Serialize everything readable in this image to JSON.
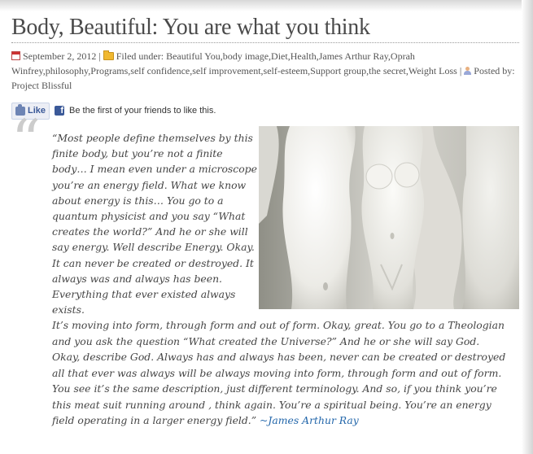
{
  "post": {
    "title": "Body, Beautiful: You are what you think",
    "meta": {
      "date": "September 2, 2012",
      "filed_under_label": "Filed under:",
      "categories": "Beautiful You,body image,Diet,Health,James Arthur Ray,Oprah Winfrey,philosophy,Programs,self confidence,self improvement,self-esteem,Support group,the secret,Weight Loss",
      "posted_by_label": "Posted by:",
      "author": "Project Blissful"
    },
    "social": {
      "like_label": "Like",
      "like_text": "Be the first of your friends to like this."
    },
    "quote": {
      "mark": "“",
      "paragraph1": "“Most people define themselves by this finite body, but you’re not a finite body… I mean even under a microscope you’re an energy field. What we know about energy is this… You go to a quantum physicist and you say “What creates the world?” And he or she will say energy. Well describe Energy. Okay. It can never be created or destroyed. It always was and always has been. Everything that ever existed always exists.",
      "paragraph2": "It’s moving into form, through form and out of form. Okay, great. You go to a Theologian and you ask the question “What created the Universe?” And he or she will say God. Okay, describe God. Always has and always has been, never can be created or destroyed all that ever was always will be always moving into form, through form and out of form. You see it’s the same description, just different terminology. And so, if you think you’re this meat suit running around , think again. You’re a spiritual being. You’re an energy field operating in a larger energy field.” ",
      "attribution": "~James Arthur Ray"
    },
    "image": {
      "subject": "white-mannequin-torsos-photo"
    }
  },
  "colors": {
    "title": "#4a4a4a",
    "link": "#2266aa",
    "facebook": "#3b5998",
    "quote_mark": "#cccccc"
  }
}
